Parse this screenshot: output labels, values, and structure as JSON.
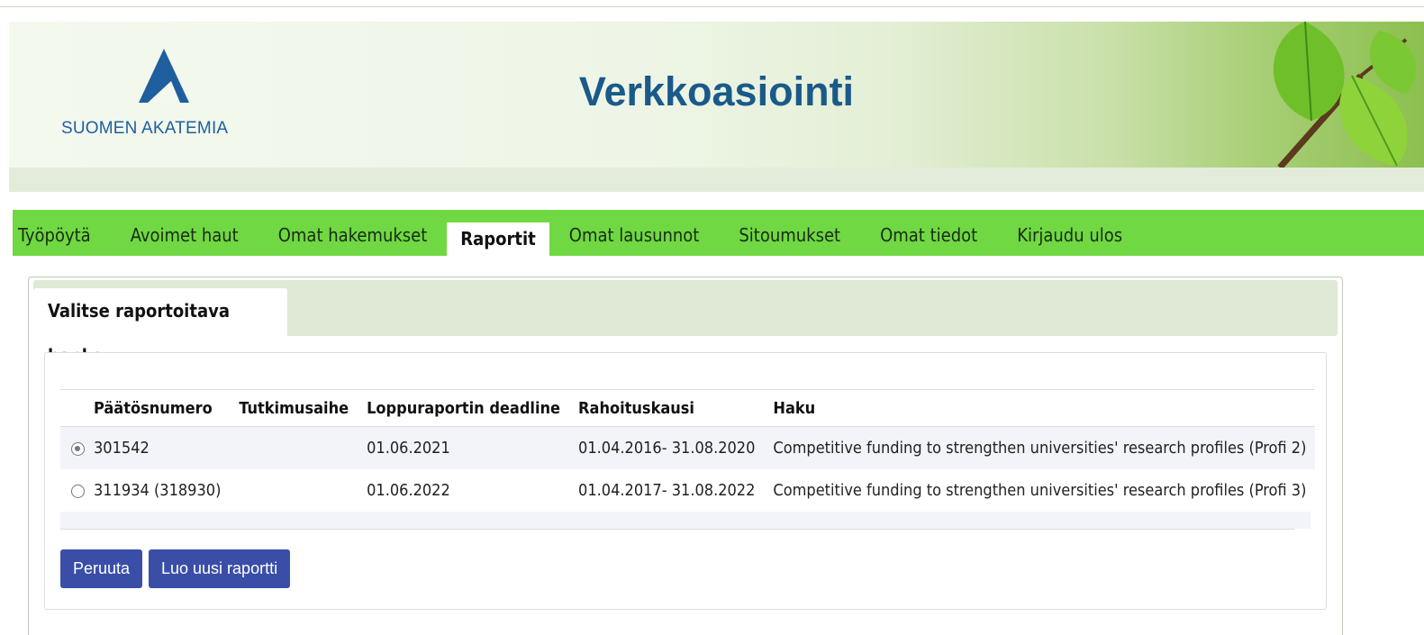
{
  "header": {
    "logo_text": "SUOMEN AKATEMIA",
    "title": "Verkkoasiointi"
  },
  "nav": {
    "items": [
      {
        "label": "Työpöytä",
        "active": false
      },
      {
        "label": "Avoimet haut",
        "active": false
      },
      {
        "label": "Omat hakemukset",
        "active": false
      },
      {
        "label": "Raportit",
        "active": true
      },
      {
        "label": "Omat lausunnot",
        "active": false
      },
      {
        "label": "Sitoumukset",
        "active": false
      },
      {
        "label": "Omat tiedot",
        "active": false
      },
      {
        "label": "Kirjaudu ulos",
        "active": false
      }
    ]
  },
  "panel": {
    "tab_label": "Valitse raportoitava hanke"
  },
  "table": {
    "columns": [
      "Päätösnumero",
      "Tutkimusaihe",
      "Loppuraportin deadline",
      "Rahoituskausi",
      "Haku"
    ],
    "rows": [
      {
        "selected": true,
        "paatosnumero": "301542",
        "tutkimusaihe": "",
        "deadline": "01.06.2021",
        "rahoituskausi": "01.04.2016- 31.08.2020",
        "haku": "Competitive funding to strengthen universities' research profiles (Profi 2)"
      },
      {
        "selected": false,
        "paatosnumero": "311934 (318930)",
        "tutkimusaihe": "",
        "deadline": "01.06.2022",
        "rahoituskausi": "01.04.2017- 31.08.2022",
        "haku": "Competitive funding to strengthen universities' research profiles (Profi 3)"
      }
    ]
  },
  "buttons": {
    "cancel": "Peruuta",
    "create": "Luo uusi raportti"
  },
  "colors": {
    "nav_green": "#6fd842",
    "button_blue": "#3a4ea8",
    "title_blue": "#1a5a8a"
  }
}
